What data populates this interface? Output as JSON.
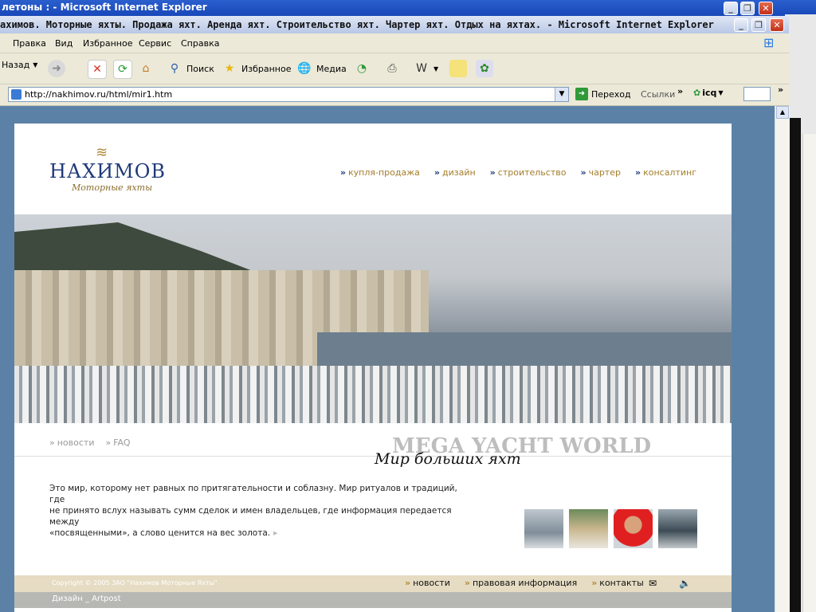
{
  "bg_window": {
    "title": "летоны : - Microsoft Internet Explorer"
  },
  "window": {
    "title": "ахимов. Моторные яхты. Продажа яхт. Аренда яхт. Строительство яхт. Чартер яхт. Отдых на яхтах. - Microsoft Internet Explorer"
  },
  "menu": [
    "Правка",
    "Вид",
    "Избранное",
    "Сервис",
    "Справка"
  ],
  "toolbar": {
    "back": "Назад",
    "search": "Поиск",
    "favorites": "Избранное",
    "media": "Медиа"
  },
  "address": {
    "url": "http://nakhimov.ru/html/mir1.htm",
    "go": "Переход",
    "links": "Ссылки",
    "icq": "icq"
  },
  "logo": {
    "name": "НАХИМОВ",
    "subtitle": "Моторные яхты"
  },
  "nav": [
    "купля-продажа",
    "дизайн",
    "строительство",
    "чартер",
    "консалтинг"
  ],
  "sublinks": [
    "новости",
    "FAQ"
  ],
  "headline": {
    "mega": "MEGA YACHT WORLD",
    "mir": "Мир больших яхт"
  },
  "intro": {
    "line1": "Это мир, которому нет равных по притягательности и соблазну. Мир ритуалов и традиций, где",
    "line2": "не принято вслух называть сумм сделок и имен владельцев, где информация передается между",
    "line3": "«посвященными», а слово ценится на вес золота."
  },
  "footer": {
    "copyright": "Copyright © 2005 ЗАО \"Нахимов Моторные Яхты\"",
    "links": [
      "новости",
      "правовая информация",
      "контакты"
    ],
    "design": "Дизайн _ Artpost"
  },
  "colors": {
    "brand_navy": "#1f3a78",
    "brand_gold": "#a27d2a",
    "page_bg": "#5b82a6",
    "footer_beige": "#e6dcc3",
    "footer_grey": "#b7b8b4"
  }
}
